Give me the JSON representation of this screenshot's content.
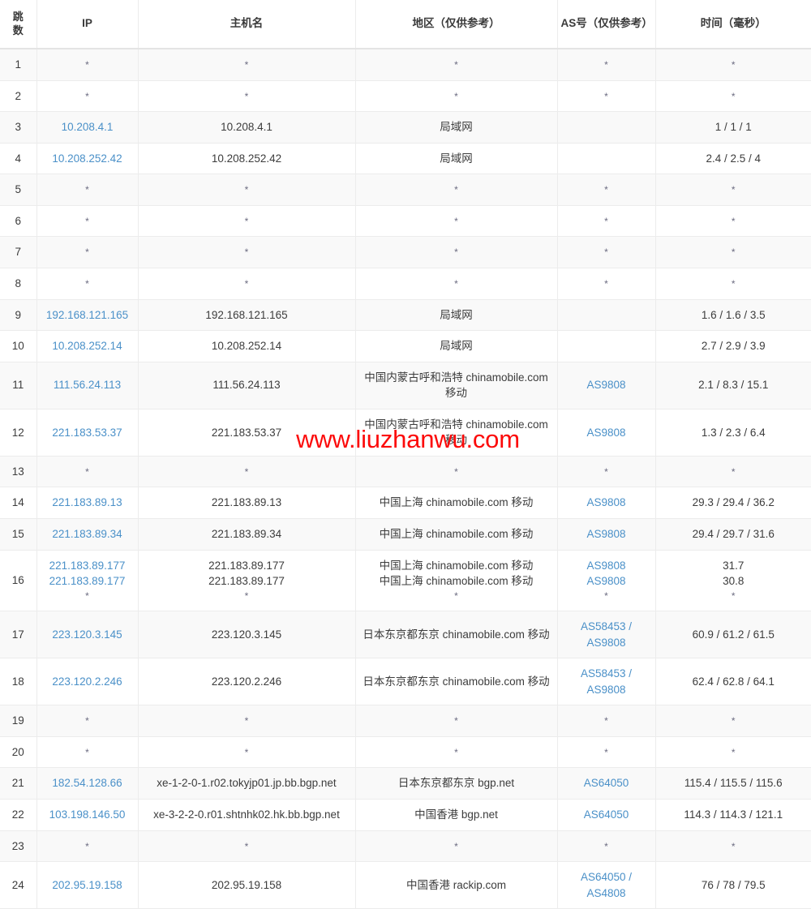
{
  "table": {
    "columns": [
      {
        "key": "hop",
        "label": "跳\n数"
      },
      {
        "key": "ip",
        "label": "IP"
      },
      {
        "key": "host",
        "label": "主机名"
      },
      {
        "key": "geo",
        "label": "地区（仅供参考）"
      },
      {
        "key": "as",
        "label": "AS号（仅供参考）"
      },
      {
        "key": "time",
        "label": "时间（毫秒）"
      }
    ],
    "headers": {
      "hop": "跳数",
      "hop_line1": "跳",
      "hop_line2": "数",
      "ip": "IP",
      "host": "主机名",
      "geo": "地区（仅供参考）",
      "as": "AS号（仅供参考）",
      "time": "时间（毫秒）"
    },
    "star": "*",
    "rows": [
      {
        "hop": "1",
        "ip": [
          "*"
        ],
        "ip_link": false,
        "host": [
          "*"
        ],
        "geo": [
          "*"
        ],
        "as": [
          "*"
        ],
        "as_link": false,
        "time": [
          "*"
        ]
      },
      {
        "hop": "2",
        "ip": [
          "*"
        ],
        "ip_link": false,
        "host": [
          "*"
        ],
        "geo": [
          "*"
        ],
        "as": [
          "*"
        ],
        "as_link": false,
        "time": [
          "*"
        ]
      },
      {
        "hop": "3",
        "ip": [
          "10.208.4.1"
        ],
        "ip_link": true,
        "host": [
          "10.208.4.1"
        ],
        "geo": [
          "局域网"
        ],
        "as": [
          ""
        ],
        "as_link": false,
        "time": [
          "1 / 1 / 1"
        ]
      },
      {
        "hop": "4",
        "ip": [
          "10.208.252.42"
        ],
        "ip_link": true,
        "host": [
          "10.208.252.42"
        ],
        "geo": [
          "局域网"
        ],
        "as": [
          ""
        ],
        "as_link": false,
        "time": [
          "2.4 / 2.5 / 4"
        ]
      },
      {
        "hop": "5",
        "ip": [
          "*"
        ],
        "ip_link": false,
        "host": [
          "*"
        ],
        "geo": [
          "*"
        ],
        "as": [
          "*"
        ],
        "as_link": false,
        "time": [
          "*"
        ]
      },
      {
        "hop": "6",
        "ip": [
          "*"
        ],
        "ip_link": false,
        "host": [
          "*"
        ],
        "geo": [
          "*"
        ],
        "as": [
          "*"
        ],
        "as_link": false,
        "time": [
          "*"
        ]
      },
      {
        "hop": "7",
        "ip": [
          "*"
        ],
        "ip_link": false,
        "host": [
          "*"
        ],
        "geo": [
          "*"
        ],
        "as": [
          "*"
        ],
        "as_link": false,
        "time": [
          "*"
        ]
      },
      {
        "hop": "8",
        "ip": [
          "*"
        ],
        "ip_link": false,
        "host": [
          "*"
        ],
        "geo": [
          "*"
        ],
        "as": [
          "*"
        ],
        "as_link": false,
        "time": [
          "*"
        ]
      },
      {
        "hop": "9",
        "ip": [
          "192.168.121.165"
        ],
        "ip_link": true,
        "host": [
          "192.168.121.165"
        ],
        "geo": [
          "局域网"
        ],
        "as": [
          ""
        ],
        "as_link": false,
        "time": [
          "1.6 / 1.6 / 3.5"
        ]
      },
      {
        "hop": "10",
        "ip": [
          "10.208.252.14"
        ],
        "ip_link": true,
        "host": [
          "10.208.252.14"
        ],
        "geo": [
          "局域网"
        ],
        "as": [
          ""
        ],
        "as_link": false,
        "time": [
          "2.7 / 2.9 / 3.9"
        ]
      },
      {
        "hop": "11",
        "ip": [
          "111.56.24.113"
        ],
        "ip_link": true,
        "host": [
          "111.56.24.113"
        ],
        "geo": [
          "中国内蒙古呼和浩特 chinamobile.com 移动"
        ],
        "as": [
          "AS9808"
        ],
        "as_link": true,
        "time": [
          "2.1 / 8.3 / 15.1"
        ]
      },
      {
        "hop": "12",
        "ip": [
          "221.183.53.37"
        ],
        "ip_link": true,
        "host": [
          "221.183.53.37"
        ],
        "geo": [
          "中国内蒙古呼和浩特 chinamobile.com 移动"
        ],
        "as": [
          "AS9808"
        ],
        "as_link": true,
        "time": [
          "1.3 / 2.3 / 6.4"
        ]
      },
      {
        "hop": "13",
        "ip": [
          "*"
        ],
        "ip_link": false,
        "host": [
          "*"
        ],
        "geo": [
          "*"
        ],
        "as": [
          "*"
        ],
        "as_link": false,
        "time": [
          "*"
        ]
      },
      {
        "hop": "14",
        "ip": [
          "221.183.89.13"
        ],
        "ip_link": true,
        "host": [
          "221.183.89.13"
        ],
        "geo": [
          "中国上海 chinamobile.com 移动"
        ],
        "as": [
          "AS9808"
        ],
        "as_link": true,
        "time": [
          "29.3 / 29.4 / 36.2"
        ]
      },
      {
        "hop": "15",
        "ip": [
          "221.183.89.34"
        ],
        "ip_link": true,
        "host": [
          "221.183.89.34"
        ],
        "geo": [
          "中国上海 chinamobile.com 移动"
        ],
        "as": [
          "AS9808"
        ],
        "as_link": true,
        "time": [
          "29.4 / 29.7 / 31.6"
        ]
      },
      {
        "hop": "16",
        "ip": [
          "221.183.89.177",
          "221.183.89.177",
          "*"
        ],
        "ip_link": true,
        "host": [
          "221.183.89.177",
          "221.183.89.177",
          "*"
        ],
        "geo": [
          "中国上海 chinamobile.com 移动",
          "中国上海 chinamobile.com 移动",
          "*"
        ],
        "as": [
          "AS9808",
          "AS9808",
          "*"
        ],
        "as_link": true,
        "time": [
          "31.7",
          "30.8",
          "*"
        ]
      },
      {
        "hop": "17",
        "ip": [
          "223.120.3.145"
        ],
        "ip_link": true,
        "host": [
          "223.120.3.145"
        ],
        "geo": [
          "日本东京都东京 chinamobile.com 移动"
        ],
        "as": [
          "AS58453 /",
          "AS9808"
        ],
        "as_link": true,
        "time": [
          "60.9 / 61.2 / 61.5"
        ]
      },
      {
        "hop": "18",
        "ip": [
          "223.120.2.246"
        ],
        "ip_link": true,
        "host": [
          "223.120.2.246"
        ],
        "geo": [
          "日本东京都东京 chinamobile.com 移动"
        ],
        "as": [
          "AS58453 /",
          "AS9808"
        ],
        "as_link": true,
        "time": [
          "62.4 / 62.8 / 64.1"
        ]
      },
      {
        "hop": "19",
        "ip": [
          "*"
        ],
        "ip_link": false,
        "host": [
          "*"
        ],
        "geo": [
          "*"
        ],
        "as": [
          "*"
        ],
        "as_link": false,
        "time": [
          "*"
        ]
      },
      {
        "hop": "20",
        "ip": [
          "*"
        ],
        "ip_link": false,
        "host": [
          "*"
        ],
        "geo": [
          "*"
        ],
        "as": [
          "*"
        ],
        "as_link": false,
        "time": [
          "*"
        ]
      },
      {
        "hop": "21",
        "ip": [
          "182.54.128.66"
        ],
        "ip_link": true,
        "host": [
          "xe-1-2-0-1.r02.tokyjp01.jp.bb.bgp.net"
        ],
        "geo": [
          "日本东京都东京 bgp.net"
        ],
        "as": [
          "AS64050"
        ],
        "as_link": true,
        "time": [
          "115.4 / 115.5 / 115.6"
        ]
      },
      {
        "hop": "22",
        "ip": [
          "103.198.146.50"
        ],
        "ip_link": true,
        "host": [
          "xe-3-2-2-0.r01.shtnhk02.hk.bb.bgp.net"
        ],
        "geo": [
          "中国香港 bgp.net"
        ],
        "as": [
          "AS64050"
        ],
        "as_link": true,
        "time": [
          "114.3 / 114.3 / 121.1"
        ]
      },
      {
        "hop": "23",
        "ip": [
          "*"
        ],
        "ip_link": false,
        "host": [
          "*"
        ],
        "geo": [
          "*"
        ],
        "as": [
          "*"
        ],
        "as_link": false,
        "time": [
          "*"
        ]
      },
      {
        "hop": "24",
        "ip": [
          "202.95.19.158"
        ],
        "ip_link": true,
        "host": [
          "202.95.19.158"
        ],
        "geo": [
          "中国香港 rackip.com"
        ],
        "as": [
          "AS64050 /",
          "AS4808"
        ],
        "as_link": true,
        "time": [
          "76 / 78 / 79.5"
        ]
      }
    ]
  },
  "watermark": {
    "text": "www.liuzhanwu.com",
    "color": "#fc0a0a"
  },
  "colors": {
    "link": "#4a90c8",
    "stripe": "#f9f9f9",
    "border": "#ececec",
    "text": "#3c3c3c",
    "watermark": "#fc0a0a"
  }
}
